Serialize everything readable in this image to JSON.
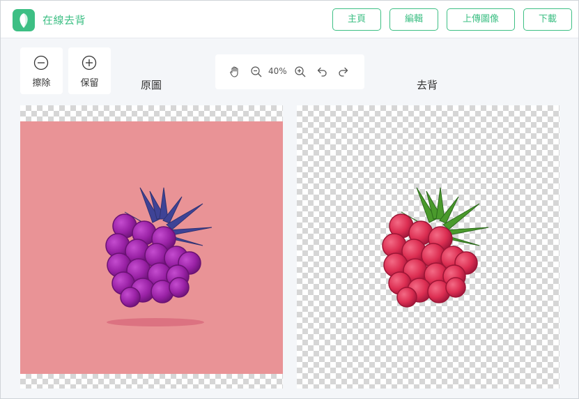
{
  "app": {
    "title": "在線去背"
  },
  "nav": {
    "home": "主頁",
    "edit": "編輯",
    "upload": "上傳圖像",
    "download": "下載"
  },
  "tools": {
    "erase": "擦除",
    "keep": "保留"
  },
  "zoom": {
    "value": "40%"
  },
  "panels": {
    "original": "原圖",
    "removed": "去背"
  },
  "colors": {
    "accent": "#3dbf84",
    "photo_bg": "#e99396",
    "berry_purple": "#9c27a8",
    "berry_red": "#e03a5a",
    "leaf_blue": "#3a3d8a",
    "leaf_green": "#3d8a26"
  },
  "icons": [
    "hand-icon",
    "zoom-out-icon",
    "zoom-in-icon",
    "undo-icon",
    "redo-icon",
    "minus-circle-icon",
    "plus-circle-icon"
  ]
}
